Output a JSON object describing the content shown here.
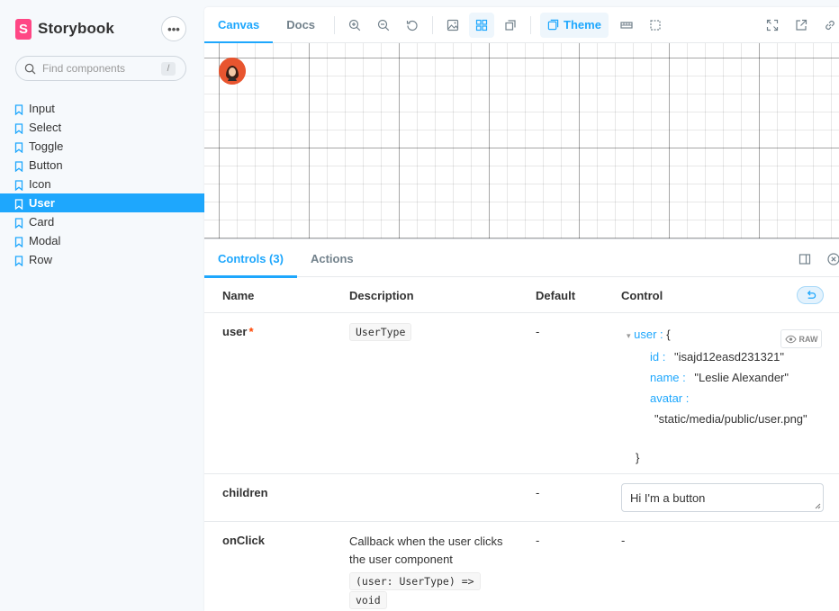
{
  "brand": {
    "name": "Storybook",
    "logo_letter": "S",
    "accent": "#ff4785"
  },
  "search": {
    "placeholder": "Find components",
    "shortcut": "/"
  },
  "sidebar": {
    "items": [
      {
        "label": "Input",
        "active": false
      },
      {
        "label": "Select",
        "active": false
      },
      {
        "label": "Toggle",
        "active": false
      },
      {
        "label": "Button",
        "active": false
      },
      {
        "label": "Icon",
        "active": false
      },
      {
        "label": "User",
        "active": true
      },
      {
        "label": "Card",
        "active": false
      },
      {
        "label": "Modal",
        "active": false
      },
      {
        "label": "Row",
        "active": false
      }
    ]
  },
  "toolbar": {
    "tabs": [
      {
        "label": "Canvas",
        "active": true
      },
      {
        "label": "Docs",
        "active": false
      }
    ],
    "theme_label": "Theme",
    "icons": [
      "zoom-in-icon",
      "zoom-out-icon",
      "zoom-reset-icon",
      "background-icon",
      "grid-icon",
      "outline-icon",
      "theme-icon",
      "measure-icon",
      "viewport-icon",
      "fullscreen-icon",
      "open-new-tab-icon",
      "copy-link-icon"
    ]
  },
  "addons": {
    "tabs": [
      {
        "label": "Controls (3)",
        "active": true
      },
      {
        "label": "Actions",
        "active": false
      }
    ],
    "headers": {
      "name": "Name",
      "description": "Description",
      "default": "Default",
      "control": "Control"
    },
    "rows": {
      "user": {
        "name": "user",
        "required_mark": "*",
        "type": "UserType",
        "default": "-",
        "json": {
          "toggle": "user :",
          "open": "{",
          "id_key": "id :",
          "id_val": "\"isajd12easd231321\"",
          "name_key": "name :",
          "name_val": "\"Leslie Alexander\"",
          "avatar_key": "avatar :",
          "avatar_val": "\"static/media/public/user.png\"",
          "close": "}"
        },
        "raw_label": "RAW"
      },
      "children": {
        "name": "children",
        "default": "-",
        "value": "Hi I'm a button"
      },
      "onclick": {
        "name": "onClick",
        "description": "Callback when the user clicks the user component",
        "type_line1": "(user: UserType) =>",
        "type_line2": "void",
        "default": "-",
        "control": "-"
      }
    }
  },
  "colors": {
    "primary": "#1ea7fd",
    "required": "#ff4400",
    "sidebar_bg": "#f6f9fc"
  }
}
